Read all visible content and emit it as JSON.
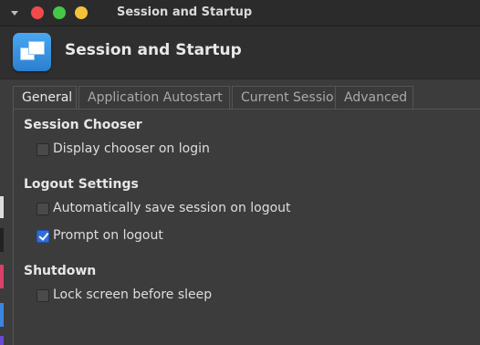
{
  "window": {
    "title": "Session and Startup"
  },
  "header": {
    "title": "Session and Startup",
    "icon": "session-windows-icon"
  },
  "tabs": [
    {
      "label": "General",
      "active": true
    },
    {
      "label": "Application Autostart",
      "active": false
    },
    {
      "label": "Current Session",
      "active": false
    },
    {
      "label": "Advanced",
      "active": false
    }
  ],
  "sections": {
    "session_chooser": {
      "title": "Session Chooser",
      "options": [
        {
          "label": "Display chooser on login",
          "checked": false
        }
      ]
    },
    "logout_settings": {
      "title": "Logout Settings",
      "options": [
        {
          "label": "Automatically save session on logout",
          "checked": false
        },
        {
          "label": "Prompt on logout",
          "checked": true
        }
      ]
    },
    "shutdown": {
      "title": "Shutdown",
      "options": [
        {
          "label": "Lock screen before sleep",
          "checked": false
        }
      ]
    }
  },
  "colors": {
    "close": "#f04a4a",
    "maximize": "#44c848",
    "minimize": "#f3c13a",
    "accent": "#2f6fd6"
  }
}
